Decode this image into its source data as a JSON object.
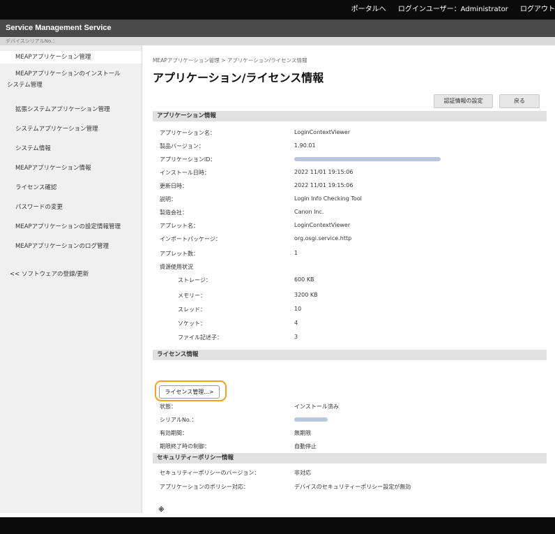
{
  "topbar": {
    "portal_link": "ポータルへ",
    "login_user": "ログインユーザー：Administrator",
    "logout": "ログアウト"
  },
  "header": {
    "service_title": "Service Management Service"
  },
  "device_bar": {
    "label": "デバイスシリアルNo.："
  },
  "sidebar": {
    "items": [
      {
        "label": "MEAPアプリケーション管理"
      },
      {
        "label": "MEAPアプリケーションのインストール"
      },
      {
        "label": "システム管理"
      },
      {
        "label": "拡張システムアプリケーション管理"
      },
      {
        "label": "システムアプリケーション管理"
      },
      {
        "label": "システム情報"
      },
      {
        "label": "MEAPアプリケーション情報"
      },
      {
        "label": "ライセンス確認"
      },
      {
        "label": "パスワードの変更"
      },
      {
        "label": "MEAPアプリケーションの設定情報管理"
      },
      {
        "label": "MEAPアプリケーションのログ管理"
      }
    ],
    "software_link": "<< ソフトウェアの登録/更新"
  },
  "main": {
    "breadcrumb": "MEAPアプリケーション管理 > アプリケーション/ライセンス情報",
    "page_title": "アプリケーション/ライセンス情報",
    "auth_settings_button": "認証情報の設定",
    "back_button": "戻る",
    "app_section_title": "アプリケーション情報",
    "app_info": [
      {
        "label": "アプリケーション名：",
        "value": "LoginContextViewer"
      },
      {
        "label": "製品バージョン：",
        "value": "1.90.01"
      },
      {
        "label": "アプリケーションID：",
        "value": ""
      },
      {
        "label": "インストール日時：",
        "value": "2022 11/01 19:15:06"
      },
      {
        "label": "更新日時：",
        "value": "2022 11/01 19:15:06"
      },
      {
        "label": "説明：",
        "value": "Login Info Checking Tool"
      },
      {
        "label": "製造会社：",
        "value": "Canon Inc."
      },
      {
        "label": "アプレット名：",
        "value": "LoginContextViewer"
      },
      {
        "label": "インポートパッケージ：",
        "value": "org.osgi.service.http"
      },
      {
        "label": "アプレット数：",
        "value": "1"
      }
    ],
    "resource_label": "資源使用状況",
    "resources": [
      {
        "label": "ストレージ：",
        "value": "600 KB"
      },
      {
        "label": "メモリー：",
        "value": "3200 KB"
      },
      {
        "label": "スレッド：",
        "value": "10"
      },
      {
        "label": "ソケット：",
        "value": "4"
      },
      {
        "label": "ファイル記述子：",
        "value": "3"
      }
    ],
    "license_section_title": "ライセンス情報",
    "license_manage_button": "ライセンス管理...>",
    "license_info": [
      {
        "label": "状態：",
        "value": "インストール済み"
      },
      {
        "label": "シリアルNo.：",
        "value": ""
      },
      {
        "label": "有効期間：",
        "value": "無期限"
      },
      {
        "label": "期限終了時の制御：",
        "value": "自動停止"
      }
    ],
    "security_section_title": "セキュリティーポリシー情報",
    "security_info": [
      {
        "label": "セキュリティーポリシーのバージョン：",
        "value": "非対応"
      },
      {
        "label": "アプリケーションのポリシー対応：",
        "value": "デバイスのセキュリティーポリシー設定が無効"
      }
    ],
    "footer_mark": "※"
  },
  "colors": {
    "topbar": "#0b0b0b",
    "titlebar": "#4a4a4a",
    "section": "#e1e1e1",
    "highlight": "#f3a21a"
  }
}
